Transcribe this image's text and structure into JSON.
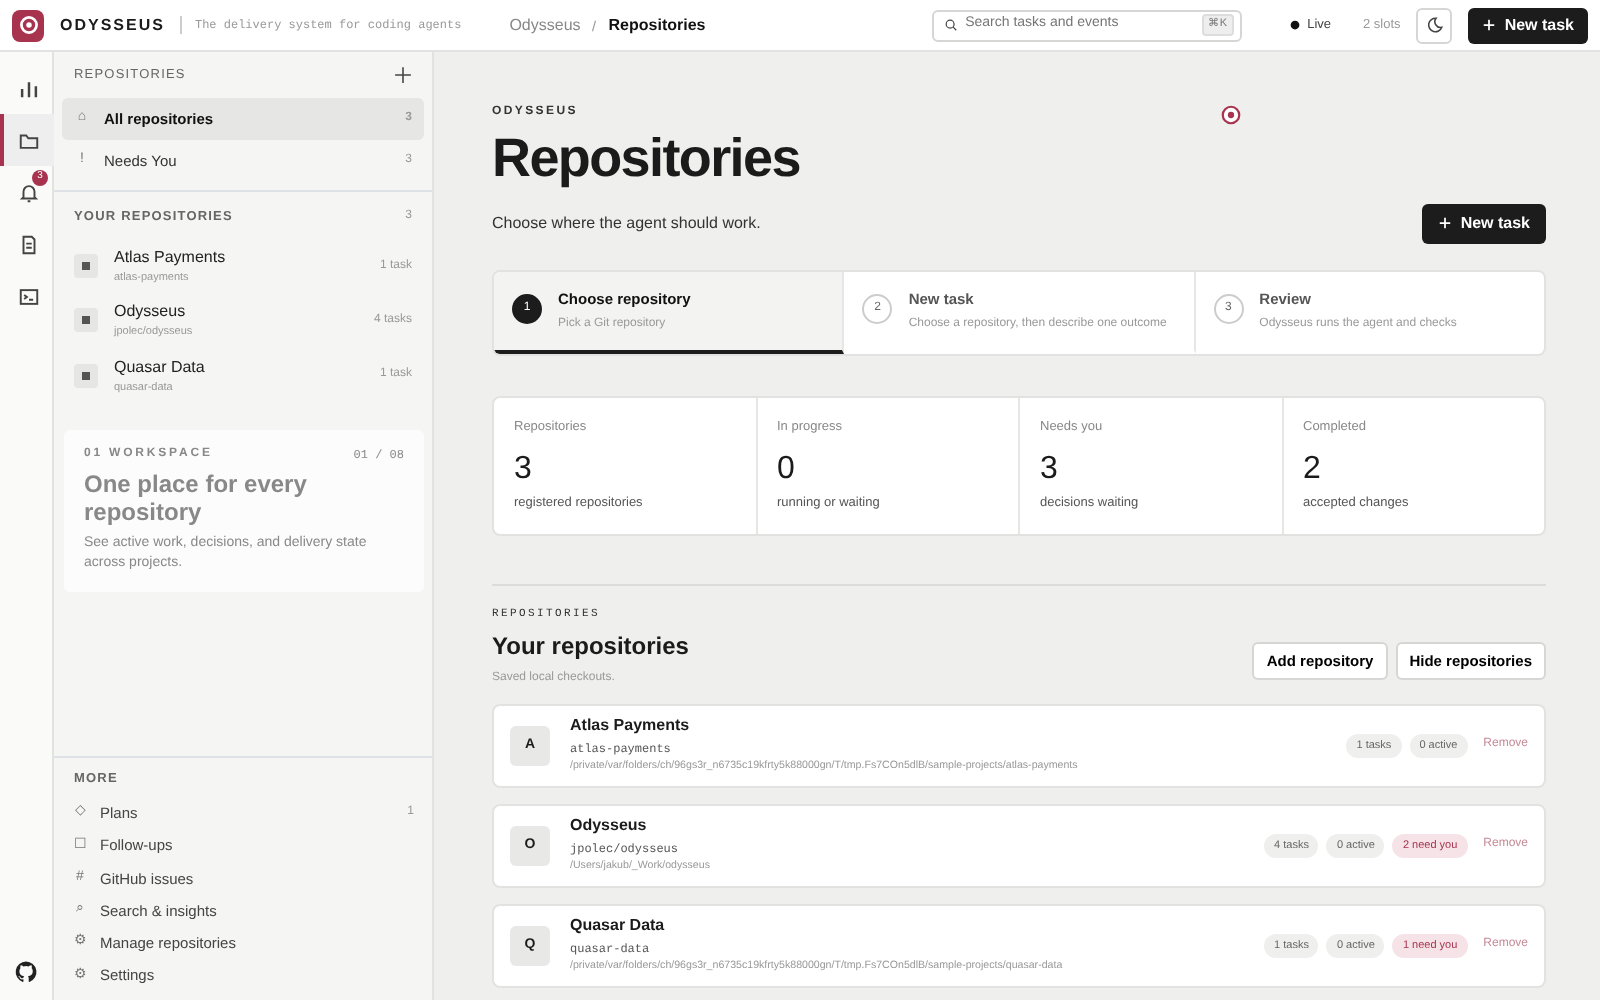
{
  "topbar": {
    "brand": "ODYSSEUS",
    "tagline": "The delivery system for coding agents",
    "breadcrumb": [
      {
        "label": "Odysseus",
        "selected": false
      },
      {
        "label": "Repositories",
        "selected": true
      }
    ],
    "search": {
      "placeholder": "Search tasks and events",
      "shortcut": "⌘K"
    },
    "status": "Live",
    "slots": "2 slots",
    "new_task": "New task"
  },
  "rail": [
    {
      "kind": "chart",
      "selected": false
    },
    {
      "kind": "folder",
      "selected": true
    },
    {
      "kind": "bell",
      "selected": false,
      "badge": "3"
    },
    {
      "kind": "doc",
      "selected": false
    },
    {
      "kind": "terminal",
      "selected": false
    }
  ],
  "sidebar": {
    "title": "REPOSITORIES",
    "items": [
      {
        "icon": "⌂",
        "label": "All repositories",
        "count": "3",
        "selected": true
      },
      {
        "icon": "!",
        "label": "Needs You",
        "count": "3",
        "selected": false
      }
    ],
    "section": "YOUR REPOSITORIES",
    "section_count": "3",
    "repos": [
      {
        "name": "Atlas Payments",
        "slug": "atlas-payments",
        "tasks": "1 task"
      },
      {
        "name": "Odysseus",
        "slug": "jpolec/odysseus",
        "tasks": "4 tasks"
      },
      {
        "name": "Quasar Data",
        "slug": "quasar-data",
        "tasks": "1 task"
      }
    ],
    "more_title": "MORE",
    "more": [
      {
        "icon": "◇",
        "label": "Plans",
        "count": "1"
      },
      {
        "icon": "☐",
        "label": "Follow-ups"
      },
      {
        "icon": "#",
        "label": "GitHub issues"
      },
      {
        "icon": "⌕",
        "label": "Search & insights"
      },
      {
        "icon": "⚙",
        "label": "Manage repositories"
      },
      {
        "icon": "⚙",
        "label": "Settings"
      }
    ]
  },
  "main": {
    "eyebrow": "ODYSSEUS",
    "title": "Repositories",
    "subtitle": "Choose where the agent should work.",
    "new_task": "New task",
    "steps": [
      {
        "number": "1",
        "title": "Choose repository",
        "text": "Pick a Git repository",
        "selected": true
      },
      {
        "number": "2",
        "title": "New task",
        "text": "Choose a repository, then describe one outcome",
        "selected": false
      },
      {
        "number": "3",
        "title": "Review",
        "text": "Odysseus runs the agent and checks",
        "selected": false
      }
    ],
    "stats": [
      {
        "label": "Repositories",
        "value": "3",
        "note": "registered repositories"
      },
      {
        "label": "In progress",
        "value": "0",
        "note": "running or waiting"
      },
      {
        "label": "Needs you",
        "value": "3",
        "note": "decisions waiting"
      },
      {
        "label": "Completed",
        "value": "2",
        "note": "accepted changes"
      }
    ],
    "section_eyebrow": "REPOSITORIES",
    "section_title": "Your repositories",
    "section_text": "Saved local checkouts.",
    "buttons": [
      "Add repository",
      "Hide repositories"
    ],
    "repos": [
      {
        "initial": "A",
        "name": "Atlas Payments",
        "slug": "atlas-payments",
        "path": "/private/var/folders/ch/96gs3r_n6735c19kfrty5k88000gn/T/tmp.Fs7COn5dlB/sample-projects/atlas-payments",
        "pills": [
          {
            "text": "1 tasks",
            "kind": "count"
          },
          {
            "text": "0 active",
            "kind": "count"
          }
        ],
        "remove": "Remove"
      },
      {
        "initial": "O",
        "name": "Odysseus",
        "slug": "jpolec/odysseus",
        "path": "/Users/jakub/_Work/odysseus",
        "pills": [
          {
            "text": "4 tasks",
            "kind": "count"
          },
          {
            "text": "0 active",
            "kind": "count"
          },
          {
            "text": "2 need you",
            "kind": "alert"
          }
        ],
        "remove": "Remove"
      },
      {
        "initial": "Q",
        "name": "Quasar Data",
        "slug": "quasar-data",
        "path": "/private/var/folders/ch/96gs3r_n6735c19kfrty5k88000gn/T/tmp.Fs7COn5dlB/sample-projects/quasar-data",
        "pills": [
          {
            "text": "1 tasks",
            "kind": "count"
          },
          {
            "text": "0 active",
            "kind": "count"
          },
          {
            "text": "1 need you",
            "kind": "alert"
          }
        ],
        "remove": "Remove"
      }
    ]
  },
  "tour": {
    "eyebrow": "01 WORKSPACE",
    "title": "One place for every repository",
    "text": "See active work, decisions, and delivery state across projects.",
    "counter": "01 / 08"
  }
}
